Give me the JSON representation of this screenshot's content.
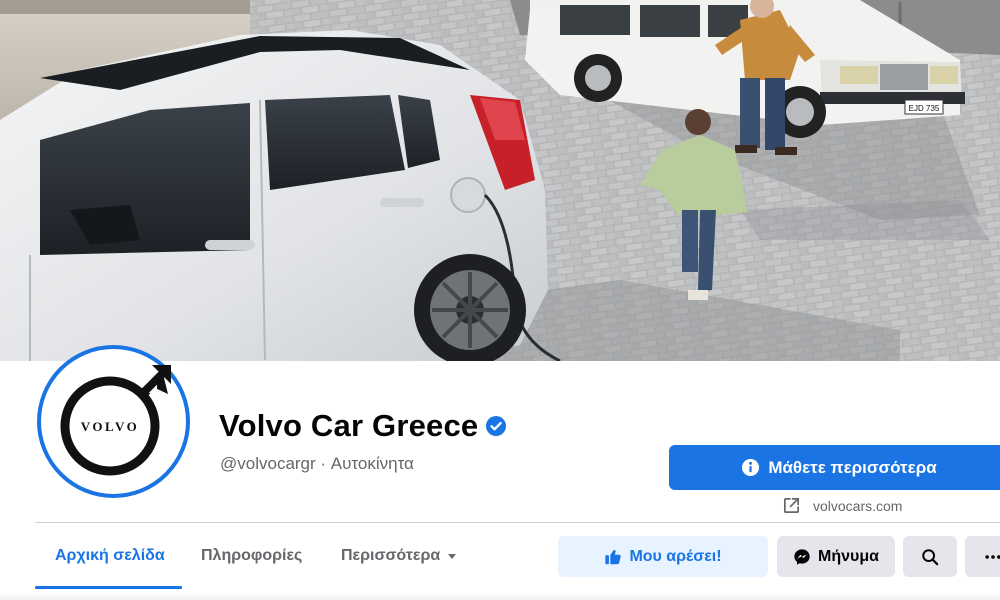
{
  "cover": {
    "plate_text": "EJD 735"
  },
  "avatar": {
    "logo_text": "VOLVO"
  },
  "page": {
    "name": "Volvo Car Greece",
    "subtitle": "@volvocargr · Αυτοκίνητα"
  },
  "cta": {
    "label": "Μάθετε περισσότερα",
    "website": "volvocars.com"
  },
  "tabs": [
    {
      "label": "Αρχική σελίδα",
      "active": true
    },
    {
      "label": "Πληροφορίες",
      "active": false
    },
    {
      "label": "Περισσότερα",
      "active": false
    }
  ],
  "actions": {
    "like_label": "Μου αρέσει!",
    "message_label": "Μήνυμα"
  },
  "colors": {
    "accent": "#1b74e4",
    "like_bg": "#e7f3ff",
    "secondary_bg": "#e4e6eb",
    "text_primary": "#050505",
    "text_secondary": "#65676b"
  },
  "icons": {
    "verified": "verified-badge-icon",
    "info": "info-icon",
    "external": "external-link-icon",
    "caret": "caret-down-icon",
    "like": "thumbs-up-icon",
    "messenger": "messenger-icon",
    "search": "search-icon",
    "more": "more-dots-icon"
  }
}
